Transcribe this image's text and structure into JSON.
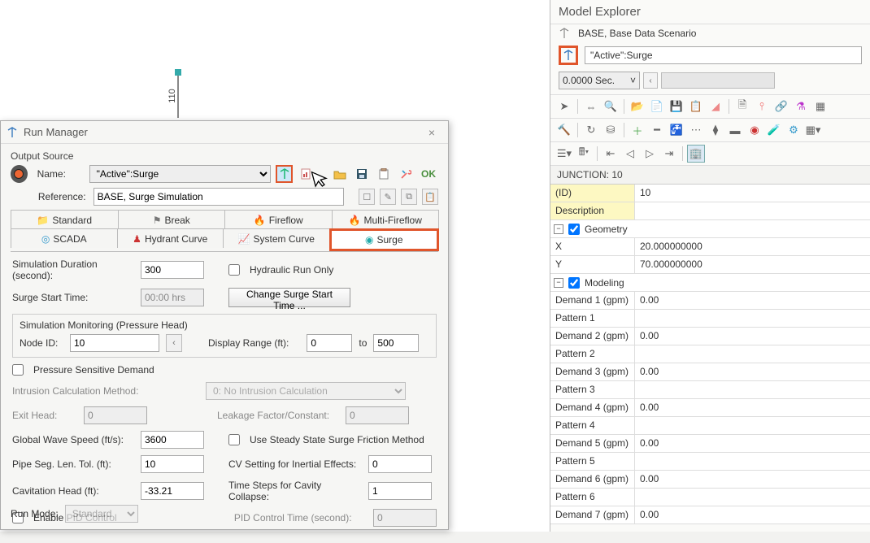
{
  "canvas": {
    "node_label": "110"
  },
  "dialog": {
    "title": "Run Manager",
    "output_source_label": "Output Source",
    "name_label": "Name:",
    "name_value": "\"Active\":Surge",
    "reference_label": "Reference:",
    "reference_value": "BASE, Surge Simulation",
    "ok_label": "OK",
    "tabs": {
      "standard": "Standard",
      "break": "Break",
      "fireflow": "Fireflow",
      "multi_fireflow": "Multi-Fireflow",
      "scada": "SCADA",
      "hydrant_curve": "Hydrant Curve",
      "system_curve": "System Curve",
      "surge": "Surge"
    },
    "sim_duration_label": "Simulation Duration (second):",
    "sim_duration_value": "300",
    "hydraulic_run_only_label": "Hydraulic Run Only",
    "surge_start_time_label": "Surge Start Time:",
    "surge_start_time_value": "00:00 hrs",
    "change_surge_btn": "Change Surge Start Time ...",
    "monitoring_label": "Simulation Monitoring (Pressure Head)",
    "node_id_label": "Node ID:",
    "node_id_value": "10",
    "display_range_label": "Display Range (ft):",
    "display_range_from": "0",
    "display_range_to_label": "to",
    "display_range_to": "500",
    "psd_label": "Pressure Sensitive Demand",
    "intrusion_method_label": "Intrusion Calculation Method:",
    "intrusion_method_value": "0: No Intrusion Calculation",
    "exit_head_label": "Exit Head:",
    "exit_head_value": "0",
    "leakage_label": "Leakage Factor/Constant:",
    "leakage_value": "0",
    "global_wave_label": "Global Wave Speed (ft/s):",
    "global_wave_value": "3600",
    "steady_state_label": "Use Steady State Surge Friction Method",
    "pipe_seg_label": "Pipe Seg. Len. Tol. (ft):",
    "pipe_seg_value": "10",
    "cv_setting_label": "CV Setting for Inertial Effects:",
    "cv_setting_value": "0",
    "cav_head_label": "Cavitation Head (ft):",
    "cav_head_value": "-33.21",
    "time_steps_label": "Time Steps for Cavity Collapse:",
    "time_steps_value": "1",
    "enable_pid_label": "Enable PID Control",
    "pid_time_label": "PID Control Time (second):",
    "pid_time_value": "0",
    "run_mode_label": "Run Mode:",
    "run_mode_value": "Standard"
  },
  "explorer": {
    "title": "Model Explorer",
    "base_scenario": "BASE, Base Data Scenario",
    "active_scenario": "\"Active\":Surge",
    "time_value": "0.0000 Sec.",
    "junction_header": "JUNCTION: 10",
    "rows": [
      {
        "k": "(ID)",
        "v": "10",
        "id": true
      },
      {
        "k": "Description",
        "v": "",
        "id": true
      },
      {
        "hdr": "Geometry"
      },
      {
        "k": "X",
        "v": "20.000000000"
      },
      {
        "k": "Y",
        "v": "70.000000000"
      },
      {
        "hdr": "Modeling"
      },
      {
        "k": "Demand 1 (gpm)",
        "v": "0.00"
      },
      {
        "k": "Pattern 1",
        "v": ""
      },
      {
        "k": "Demand 2 (gpm)",
        "v": "0.00"
      },
      {
        "k": "Pattern 2",
        "v": ""
      },
      {
        "k": "Demand 3 (gpm)",
        "v": "0.00"
      },
      {
        "k": "Pattern 3",
        "v": ""
      },
      {
        "k": "Demand 4 (gpm)",
        "v": "0.00"
      },
      {
        "k": "Pattern 4",
        "v": ""
      },
      {
        "k": "Demand 5 (gpm)",
        "v": "0.00"
      },
      {
        "k": "Pattern 5",
        "v": ""
      },
      {
        "k": "Demand 6 (gpm)",
        "v": "0.00"
      },
      {
        "k": "Pattern 6",
        "v": ""
      },
      {
        "k": "Demand 7 (gpm)",
        "v": "0.00"
      }
    ]
  }
}
